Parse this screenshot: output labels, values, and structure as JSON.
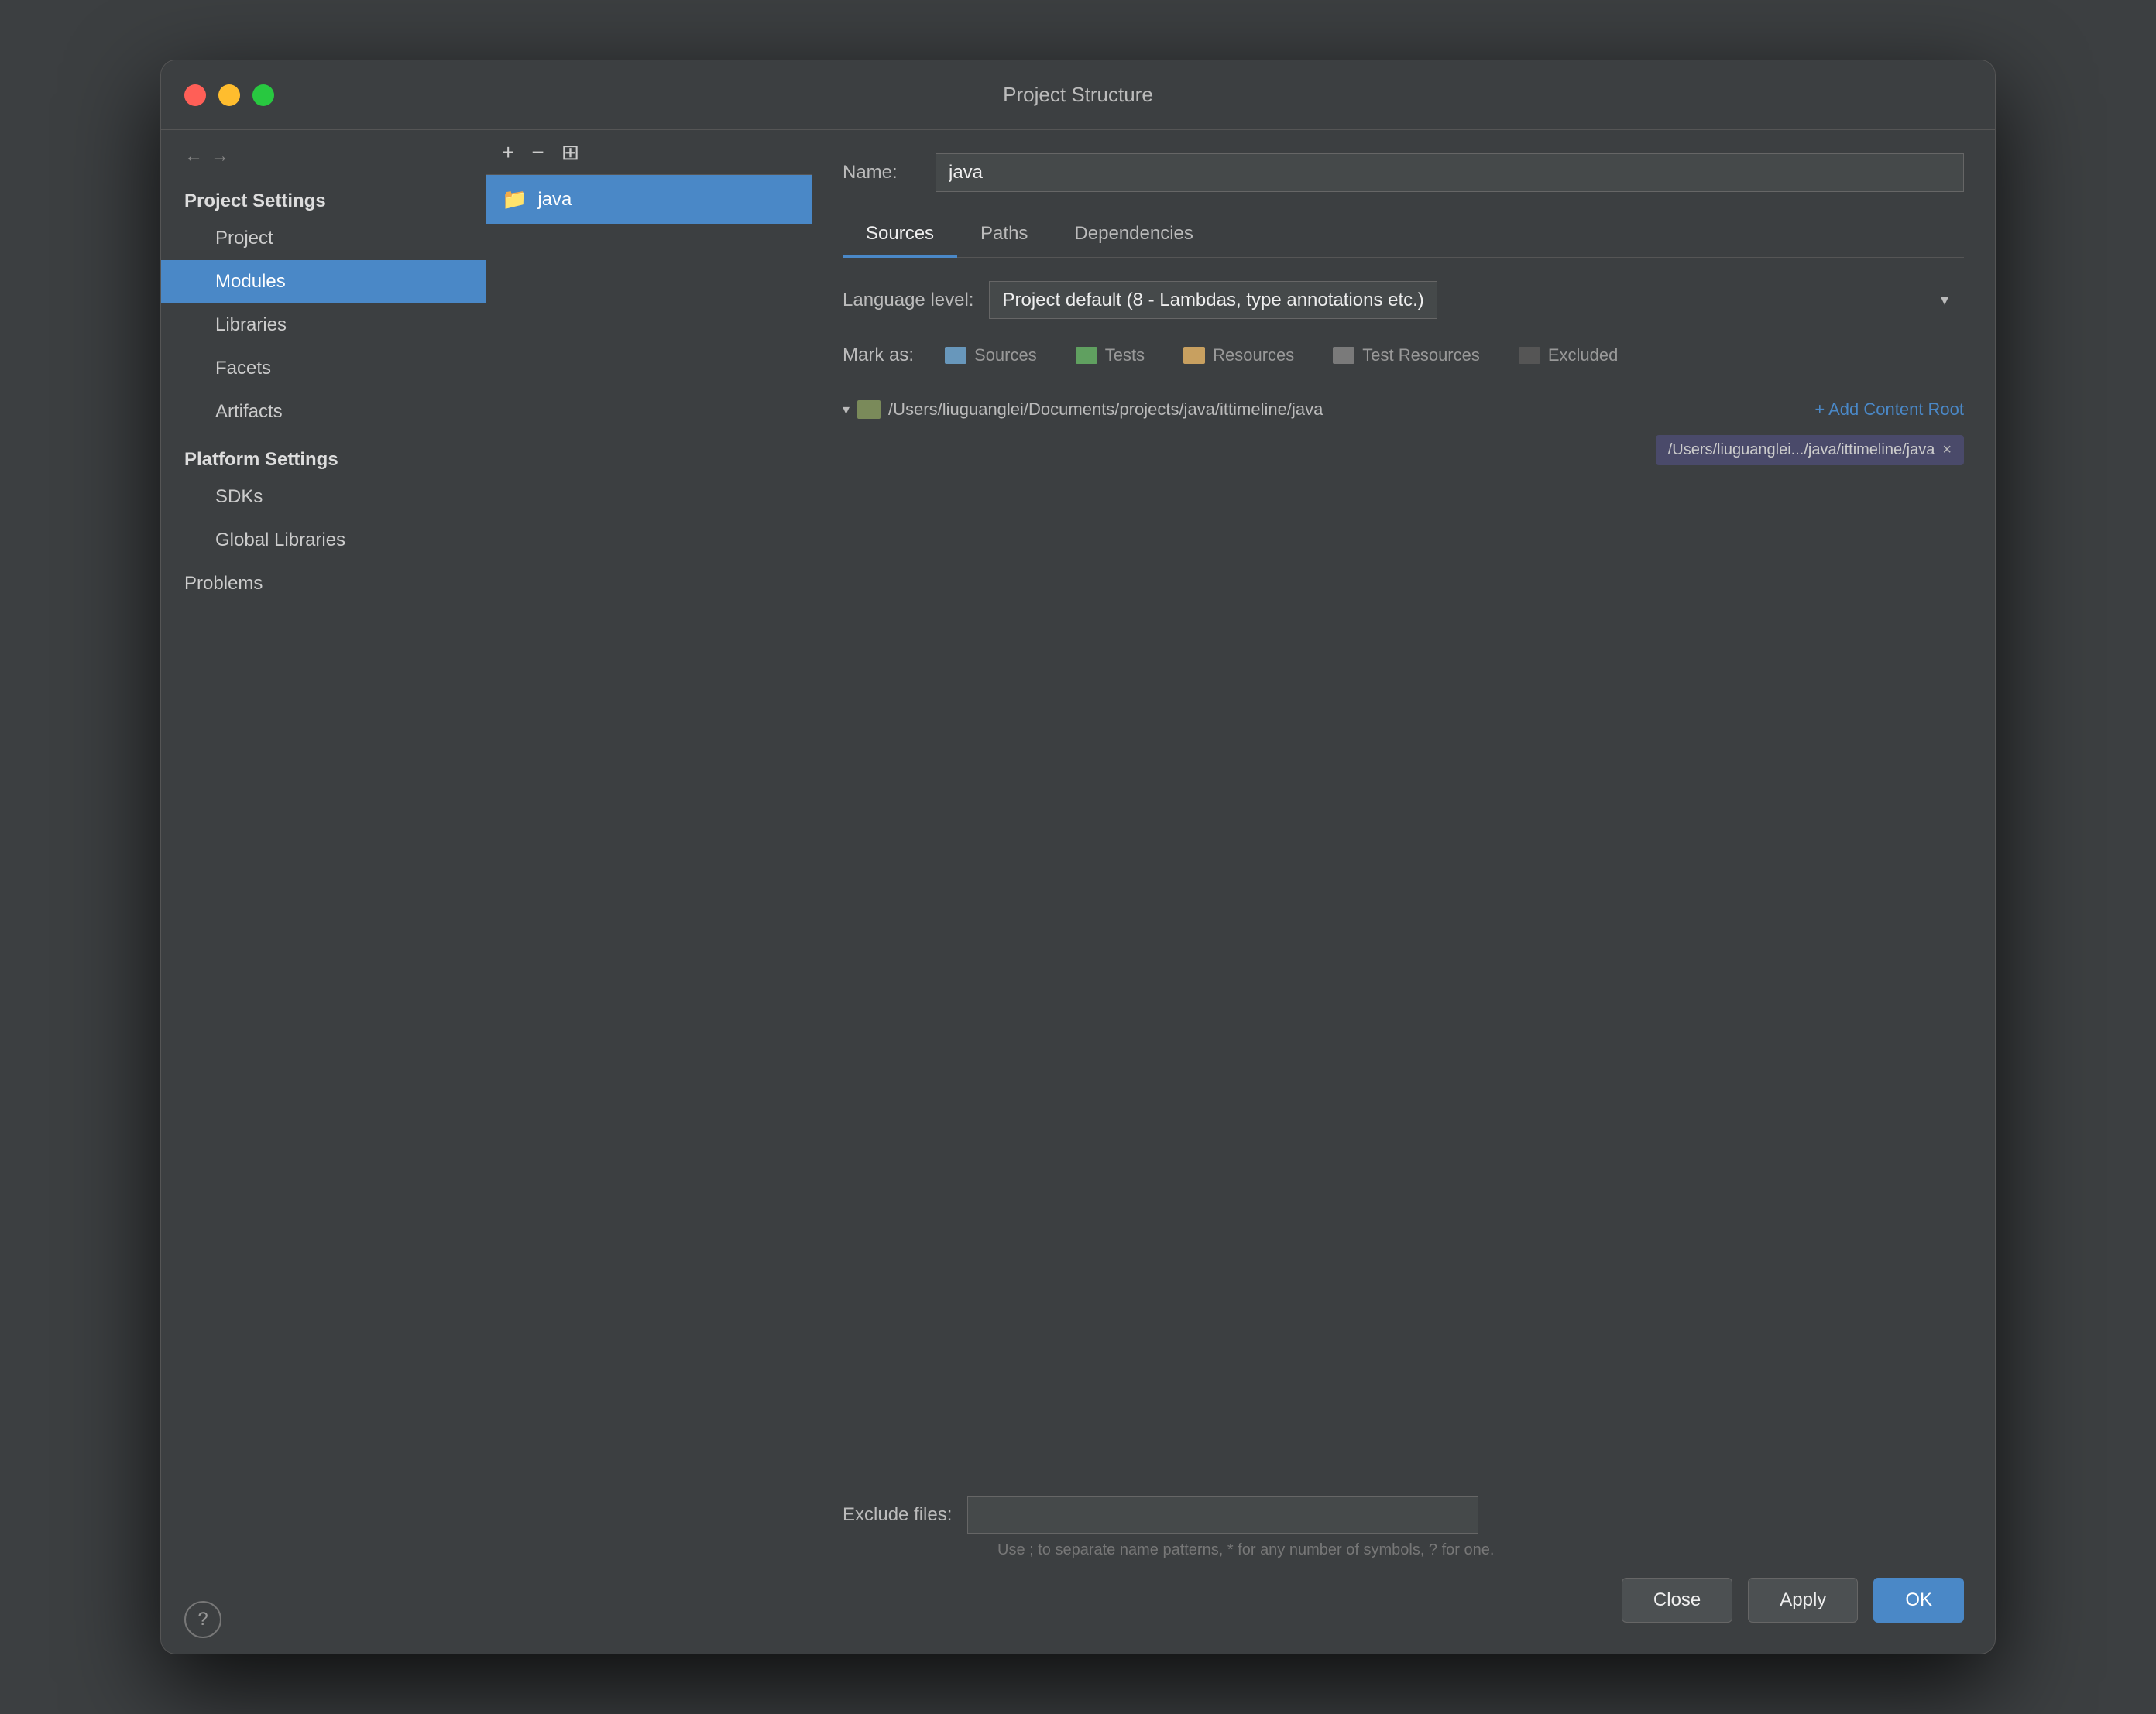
{
  "window": {
    "title": "Project Structure"
  },
  "sidebar": {
    "back_label": "←",
    "forward_label": "→",
    "project_settings_label": "Project Settings",
    "items": [
      {
        "id": "project",
        "label": "Project",
        "active": false,
        "indent": true
      },
      {
        "id": "modules",
        "label": "Modules",
        "active": true,
        "indent": true
      },
      {
        "id": "libraries",
        "label": "Libraries",
        "active": false,
        "indent": true
      },
      {
        "id": "facets",
        "label": "Facets",
        "active": false,
        "indent": true
      },
      {
        "id": "artifacts",
        "label": "Artifacts",
        "active": false,
        "indent": true
      }
    ],
    "platform_label": "Platform Settings",
    "platform_items": [
      {
        "id": "sdks",
        "label": "SDKs",
        "active": false
      },
      {
        "id": "global-libraries",
        "label": "Global Libraries",
        "active": false
      }
    ],
    "problems_label": "Problems",
    "help_label": "?"
  },
  "toolbar": {
    "add_label": "+",
    "remove_label": "−",
    "copy_label": "⊞"
  },
  "module": {
    "name_label": "Name:",
    "name_value": "java",
    "icon": "📦"
  },
  "tabs": [
    {
      "id": "sources",
      "label": "Sources",
      "active": true
    },
    {
      "id": "paths",
      "label": "Paths",
      "active": false
    },
    {
      "id": "dependencies",
      "label": "Dependencies",
      "active": false
    }
  ],
  "language_level": {
    "label": "Language level:",
    "value": "Project default (8 - Lambdas, type annotations etc.)"
  },
  "mark_as": {
    "label": "Mark as:",
    "buttons": [
      {
        "id": "sources",
        "label": "Sources",
        "color": "#6897bb"
      },
      {
        "id": "tests",
        "label": "Tests",
        "color": "#60a060"
      },
      {
        "id": "resources",
        "label": "Resources",
        "color": "#c8a060"
      },
      {
        "id": "test-resources",
        "label": "Test Resources",
        "color": "#7a7a7a"
      },
      {
        "id": "excluded",
        "label": "Excluded",
        "color": "#555"
      }
    ]
  },
  "content_root": {
    "path": "/Users/liuguanglei/Documents/projects/java/ittimeline/java",
    "add_label": "+ Add Content Root",
    "badge_label": "/Users/liuguanglei.../java/ittimeline/java",
    "badge_close": "×"
  },
  "exclude_files": {
    "label": "Exclude files:",
    "placeholder": "",
    "hint": "Use ; to separate name patterns, * for any number of symbols, ? for one."
  },
  "buttons": {
    "close_label": "Close",
    "apply_label": "Apply",
    "ok_label": "OK"
  }
}
